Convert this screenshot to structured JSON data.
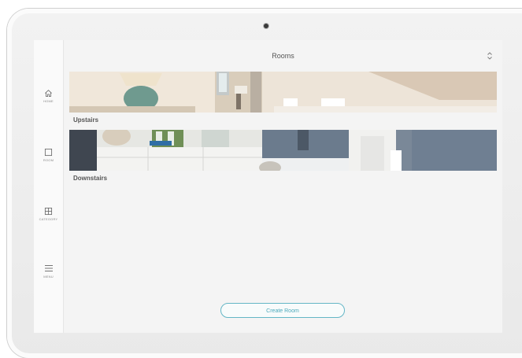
{
  "header": {
    "title": "Rooms",
    "sort_icon": "sort-updown-icon"
  },
  "sidebar": {
    "items": [
      {
        "label": "HOME",
        "icon": "home-icon"
      },
      {
        "label": "ROOM",
        "icon": "room-square-icon"
      },
      {
        "label": "CATEGORY",
        "icon": "category-grid-icon"
      },
      {
        "label": "MENU",
        "icon": "menu-icon"
      }
    ]
  },
  "rooms": [
    {
      "name": "Upstairs"
    },
    {
      "name": "Downstairs"
    }
  ],
  "actions": {
    "create_room_label": "Create Room"
  },
  "colors": {
    "accent": "#64b6c6",
    "background": "#f4f4f4",
    "sidebar": "#fafafa"
  }
}
